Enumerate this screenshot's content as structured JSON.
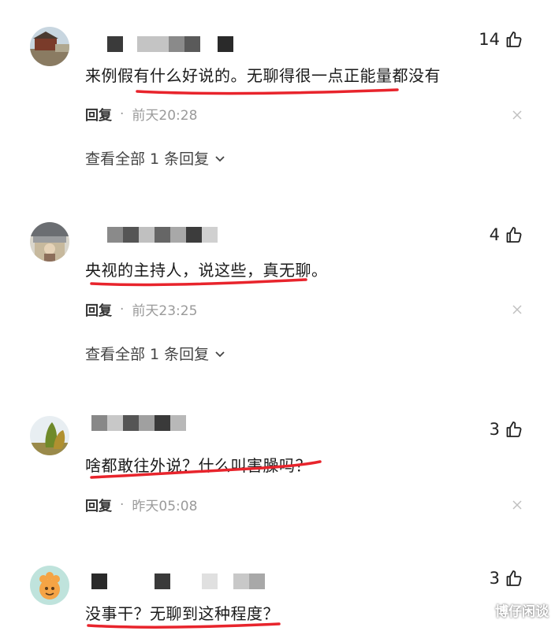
{
  "comments": [
    {
      "likes": "14",
      "text": "来例假有什么好说的。无聊得很一点正能量都没有",
      "reply_label": "回复",
      "time": "前天20:28",
      "view_all": "查看全部 1 条回复"
    },
    {
      "likes": "4",
      "text": "央视的主持人，说这些，真无聊。",
      "reply_label": "回复",
      "time": "前天23:25",
      "view_all": "查看全部 1 条回复"
    },
    {
      "likes": "3",
      "text": "啥都敢往外说？什么叫害臊吗？",
      "reply_label": "回复",
      "time": "昨天05:08"
    },
    {
      "likes": "3",
      "text": "没事干？无聊到这种程度？"
    }
  ],
  "meta_separator": "·",
  "watermark": "博仔闲谈",
  "colors": {
    "annotation_red": "#e8242c",
    "meta_gray": "#9a9a9a"
  },
  "icons": {
    "like": "thumbs-up-icon",
    "close": "close-icon",
    "expand": "chevron-down-icon"
  }
}
